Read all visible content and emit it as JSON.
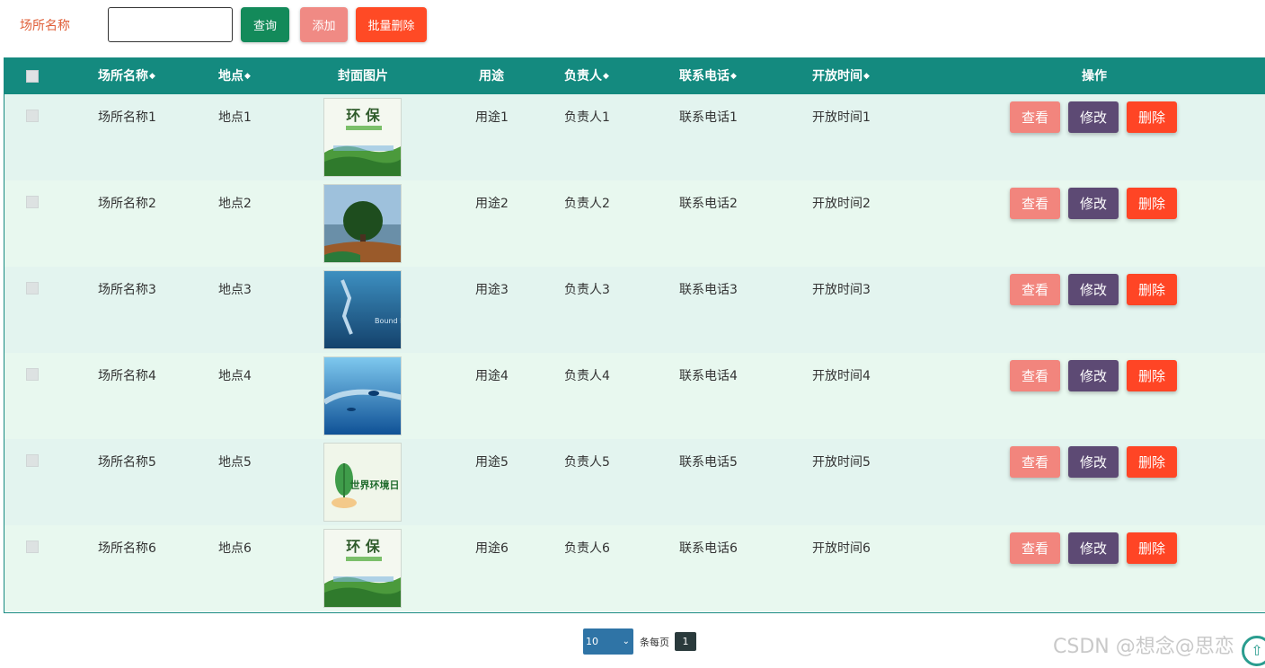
{
  "toolbar": {
    "search_label": "场所名称",
    "search_value": "",
    "query_label": "查询",
    "add_label": "添加",
    "batch_delete_label": "批量删除"
  },
  "table": {
    "headers": {
      "name": "场所名称",
      "location": "地点",
      "cover": "封面图片",
      "purpose": "用途",
      "manager": "负责人",
      "phone": "联系电话",
      "open_time": "开放时间",
      "actions": "操作"
    },
    "rows": [
      {
        "name": "场所名称1",
        "location": "地点1",
        "purpose": "用途1",
        "manager": "负责人1",
        "phone": "联系电话1",
        "open_time": "开放时间1",
        "image": "environment-poster"
      },
      {
        "name": "场所名称2",
        "location": "地点2",
        "purpose": "用途2",
        "manager": "负责人2",
        "phone": "联系电话2",
        "open_time": "开放时间2",
        "image": "tree-on-globe"
      },
      {
        "name": "场所名称3",
        "location": "地点3",
        "purpose": "用途3",
        "manager": "负责人3",
        "phone": "联系电话3",
        "open_time": "开放时间3",
        "image": "bound-for-freedom"
      },
      {
        "name": "场所名称4",
        "location": "地点4",
        "purpose": "用途4",
        "manager": "负责人4",
        "phone": "联系电话4",
        "open_time": "开放时间4",
        "image": "ocean-scene"
      },
      {
        "name": "场所名称5",
        "location": "地点5",
        "purpose": "用途5",
        "manager": "负责人5",
        "phone": "联系电话5",
        "open_time": "开放时间5",
        "image": "world-environment-day"
      },
      {
        "name": "场所名称6",
        "location": "地点6",
        "purpose": "用途6",
        "manager": "负责人6",
        "phone": "联系电话6",
        "open_time": "开放时间6",
        "image": "environment-poster"
      }
    ],
    "action_labels": {
      "view": "查看",
      "edit": "修改",
      "delete": "删除"
    }
  },
  "pagination": {
    "page_size": "10",
    "per_page_label": "条每页",
    "current_page": "1"
  },
  "watermark": "CSDN @想念@思恋",
  "image_text": {
    "poster_title": "环 保",
    "freedom": "Bound For Freedom",
    "world_env": "世界环境日"
  },
  "colors": {
    "header_bg": "#148a7f",
    "view_btn": "#f2857d",
    "edit_btn": "#5d4a74",
    "delete_btn": "#ff4525",
    "query_btn": "#138a5a"
  }
}
